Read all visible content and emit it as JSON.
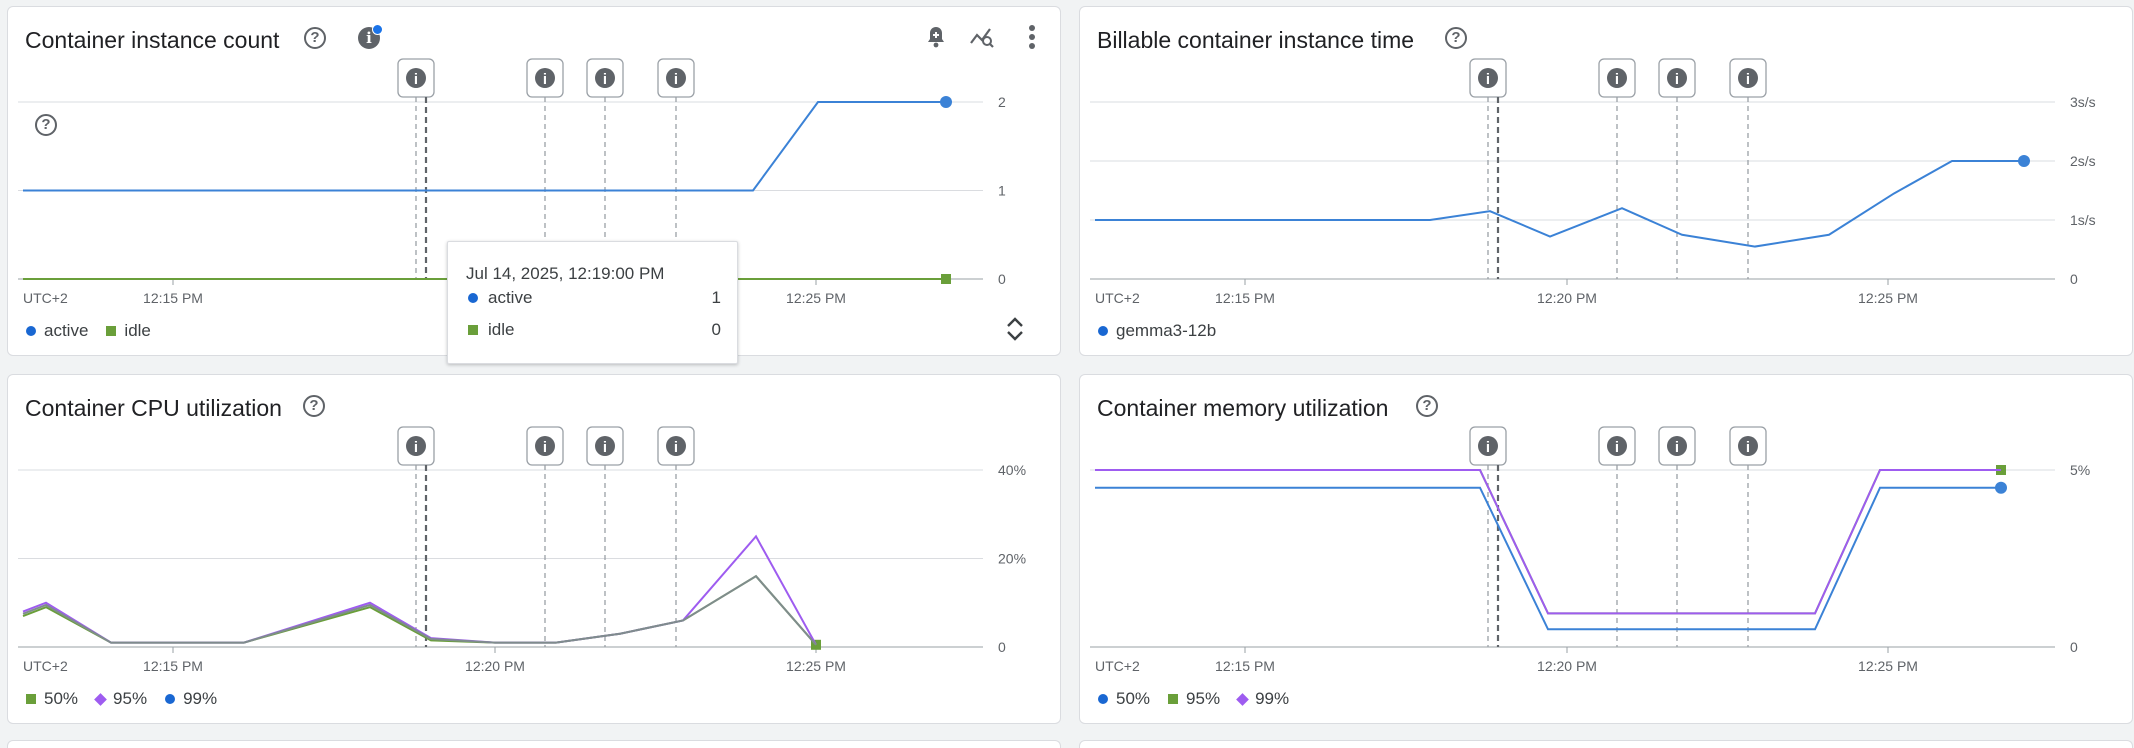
{
  "colors": {
    "blue": "#1967d2",
    "blue_line": "#3b82d6",
    "green": "#6a9f3a",
    "purple": "#9e5cf0",
    "gray_line": "#7f8c8d",
    "grid": "#dadce0",
    "axis_text": "#5f6368",
    "event_line": "#9aa0a6"
  },
  "event_badge_icon": "info-icon",
  "cards": [
    {
      "id": "instance-count",
      "title": "Container instance count",
      "has_info_badge": true,
      "has_toolbar": true,
      "toolbar": [
        "add-alert-icon",
        "explore-icon",
        "more-vert-icon"
      ],
      "legend": [
        {
          "label": "active",
          "shape": "circle",
          "color": "#1967d2"
        },
        {
          "label": "idle",
          "shape": "square",
          "color": "#6a9f3a"
        }
      ],
      "chart_data": {
        "type": "line",
        "timezone": "UTC+2",
        "x_ticks": [
          "12:15 PM",
          "12:25 PM"
        ],
        "y_ticks": [
          "2",
          "1",
          "0"
        ],
        "ylim": [
          0,
          2
        ],
        "series": [
          {
            "name": "active",
            "color": "#3b82d6",
            "marker": "circle",
            "x": [
              "12:11 PM",
              "12:23 PM",
              "12:24 PM",
              "12:26 PM"
            ],
            "values": [
              1,
              1,
              2,
              2
            ]
          },
          {
            "name": "idle",
            "color": "#6a9f3a",
            "marker": "square",
            "x": [
              "12:11 PM",
              "12:26 PM"
            ],
            "values": [
              0,
              0
            ]
          }
        ],
        "events": [
          "12:17:30 PM",
          "12:19:30 PM",
          "12:20:30 PM",
          "12:21:40 PM"
        ],
        "cursor": "12:19:00 PM",
        "has_inner_help": true
      },
      "tooltip": {
        "time": "Jul 14, 2025, 12:19:00 PM",
        "rows": [
          {
            "label": "active",
            "value": "1",
            "shape": "circle",
            "color": "#1967d2"
          },
          {
            "label": "idle",
            "value": "0",
            "shape": "square",
            "color": "#6a9f3a"
          }
        ]
      }
    },
    {
      "id": "billable-time",
      "title": "Billable container instance time",
      "legend": [
        {
          "label": "gemma3-12b",
          "shape": "circle",
          "color": "#1967d2"
        }
      ],
      "chart_data": {
        "type": "line",
        "timezone": "UTC+2",
        "x_ticks": [
          "12:15 PM",
          "12:20 PM",
          "12:25 PM"
        ],
        "y_ticks": [
          "3s/s",
          "2s/s",
          "1s/s",
          "0"
        ],
        "ylim": [
          0,
          3
        ],
        "series": [
          {
            "name": "gemma3-12b",
            "color": "#3b82d6",
            "marker": "circle",
            "x": [
              "12:11 PM",
              "12:17 PM",
              "12:18 PM",
              "12:19 PM",
              "12:20 PM",
              "12:21 PM",
              "12:22 PM",
              "12:23 PM",
              "12:24 PM",
              "12:25 PM",
              "12:26 PM"
            ],
            "values": [
              1.0,
              1.0,
              1.15,
              0.72,
              1.2,
              0.75,
              0.55,
              0.75,
              1.45,
              2.0,
              2.0
            ]
          }
        ],
        "events": [
          "12:17:30 PM",
          "12:19:30 PM",
          "12:20:30 PM",
          "12:21:40 PM"
        ],
        "cursor": "12:19:00 PM"
      }
    },
    {
      "id": "cpu-utilization",
      "title": "Container CPU utilization",
      "legend": [
        {
          "label": "50%",
          "shape": "square",
          "color": "#6a9f3a"
        },
        {
          "label": "95%",
          "shape": "diamond",
          "color": "#9e5cf0"
        },
        {
          "label": "99%",
          "shape": "circle",
          "color": "#1967d2"
        }
      ],
      "chart_data": {
        "type": "line",
        "timezone": "UTC+2",
        "x_ticks": [
          "12:15 PM",
          "12:20 PM",
          "12:25 PM"
        ],
        "y_ticks": [
          "40%",
          "20%",
          "0"
        ],
        "ylim": [
          0,
          40
        ],
        "series": [
          {
            "name": "50%",
            "color": "#6a9f3a",
            "marker": "square",
            "x": [
              "12:11 PM",
              "12:13 PM",
              "12:16 PM",
              "12:17 PM",
              "12:18 PM",
              "12:19 PM",
              "12:20 PM",
              "12:21 PM",
              "12:22 PM",
              "12:23 PM",
              "12:24 PM",
              "12:25 PM"
            ],
            "values": [
              7,
              9,
              1,
              1,
              1,
              9,
              1.5,
              1,
              1,
              3,
              6,
              16,
              0.5
            ]
          },
          {
            "name": "95%",
            "color": "#9e5cf0",
            "marker": "diamond",
            "x": [
              "12:11 PM",
              "12:13 PM",
              "12:16 PM",
              "12:17 PM",
              "12:18 PM",
              "12:19 PM",
              "12:20 PM",
              "12:21 PM",
              "12:22 PM",
              "12:23 PM",
              "12:24 PM",
              "12:25 PM"
            ],
            "values": [
              8,
              10,
              1,
              1,
              1,
              10,
              2,
              1,
              1,
              3,
              6,
              25,
              0.5
            ]
          },
          {
            "name": "99%",
            "color": "#7f8c8d",
            "marker": "circle",
            "x": [
              "12:11 PM",
              "12:13 PM",
              "12:16 PM",
              "12:17 PM",
              "12:18 PM",
              "12:19 PM",
              "12:20 PM",
              "12:21 PM",
              "12:22 PM",
              "12:23 PM",
              "12:24 PM",
              "12:25 PM"
            ],
            "values": [
              7.5,
              9.5,
              1,
              1,
              1,
              9.5,
              1.8,
              1,
              1,
              3,
              6,
              16,
              0.5
            ]
          }
        ],
        "events": [
          "12:17:30 PM",
          "12:19:30 PM",
          "12:20:30 PM",
          "12:21:40 PM"
        ],
        "cursor": "12:19:00 PM"
      }
    },
    {
      "id": "memory-utilization",
      "title": "Container memory utilization",
      "legend": [
        {
          "label": "50%",
          "shape": "circle",
          "color": "#1967d2"
        },
        {
          "label": "95%",
          "shape": "square",
          "color": "#6a9f3a"
        },
        {
          "label": "99%",
          "shape": "diamond",
          "color": "#9e5cf0"
        }
      ],
      "chart_data": {
        "type": "line",
        "timezone": "UTC+2",
        "x_ticks": [
          "12:15 PM",
          "12:20 PM",
          "12:25 PM"
        ],
        "y_ticks": [
          "5%",
          "0"
        ],
        "ylim": [
          0,
          5
        ],
        "series": [
          {
            "name": "50%",
            "color": "#3b82d6",
            "marker": "circle",
            "values": [
              4.5,
              4.5,
              0.5,
              0.5,
              4.5,
              4.5
            ]
          },
          {
            "name": "95%",
            "color": "#6a9f3a",
            "marker": "square",
            "values": [
              5.0,
              5.0,
              0.95,
              0.95,
              5.0,
              5.0
            ]
          },
          {
            "name": "99%",
            "color": "#9e5cf0",
            "marker": "diamond",
            "values": [
              5.0,
              5.0,
              0.95,
              0.95,
              5.0,
              5.0
            ]
          }
        ],
        "events": [
          "12:17:30 PM",
          "12:19:30 PM",
          "12:20:30 PM",
          "12:21:40 PM"
        ],
        "cursor": "12:19:00 PM"
      }
    }
  ]
}
